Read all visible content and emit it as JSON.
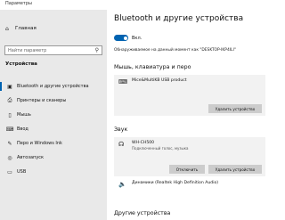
{
  "window": {
    "title": "Параметры"
  },
  "sidebar": {
    "home": {
      "label": "Главная",
      "icon": "home-icon"
    },
    "search": {
      "placeholder": "Найти параметр",
      "icon": "search-icon"
    },
    "section": "Устройства",
    "items": [
      {
        "label": "Bluetooth и другие устройства",
        "icon": "bluetooth-devices-icon",
        "active": true
      },
      {
        "label": "Принтеры и сканеры",
        "icon": "printer-icon",
        "active": false
      },
      {
        "label": "Мышь",
        "icon": "mouse-icon",
        "active": false
      },
      {
        "label": "Ввод",
        "icon": "keyboard-icon",
        "active": false
      },
      {
        "label": "Перо и Windows Ink",
        "icon": "pen-icon",
        "active": false
      },
      {
        "label": "Автозапуск",
        "icon": "autoplay-icon",
        "active": false
      },
      {
        "label": "USB",
        "icon": "usb-icon",
        "active": false
      }
    ]
  },
  "main": {
    "title": "Bluetooth и другие устройства",
    "bluetooth_toggle": {
      "label": "Вкл.",
      "on": true
    },
    "discoverable_text": "Обнаруживаемое на данный момент как \"DESKTOP-IKP4ILI\"",
    "mouse_section": {
      "title": "Мышь, клавиатура и перо",
      "device": {
        "name": "Mice&MultiKB USB product",
        "icon": "keyboard-icon"
      },
      "remove_label": "Удалить устройство"
    },
    "sound_section": {
      "title": "Звук",
      "device": {
        "name": "WH-CH500",
        "status": "Подключенный голос, музыка",
        "icon": "headphones-icon"
      },
      "disconnect_label": "Отключить",
      "remove_label": "Удалить устройство",
      "speaker": {
        "name": "Динамики (Realtek High Definition Audio)",
        "icon": "speaker-icon"
      }
    },
    "other_section": {
      "title": "Другие устройства"
    }
  },
  "colors": {
    "accent": "#0063b1",
    "sidebar_bg": "#e9e9e9",
    "card_bg": "#f2f2f2",
    "button_bg": "#cccccc"
  }
}
